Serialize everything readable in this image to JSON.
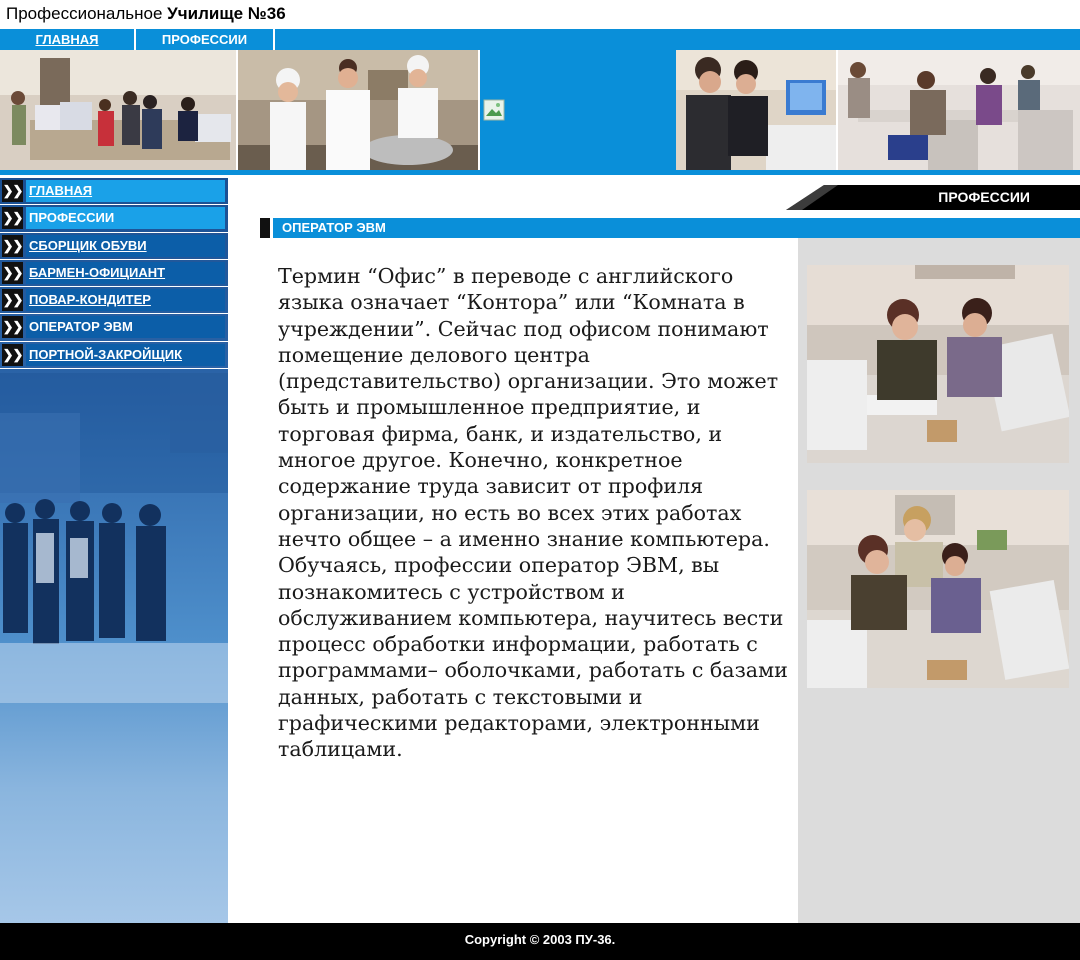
{
  "window": {
    "title_regular": "Профессиональное ",
    "title_bold": "Училище №36"
  },
  "topnav": {
    "items": [
      {
        "label": "ГЛАВНАЯ"
      },
      {
        "label": "ПРОФЕССИИ"
      }
    ]
  },
  "sidebar": {
    "bullet": "❯❯",
    "items": [
      {
        "label": "ГЛАВНАЯ"
      },
      {
        "label": "ПРОФЕССИИ"
      },
      {
        "label": "СБОРЩИК ОБУВИ"
      },
      {
        "label": "БАРМЕН-ОФИЦИАНТ"
      },
      {
        "label": "ПОВАР-КОНДИТЕР"
      },
      {
        "label": "ОПЕРАТОР ЭВМ"
      },
      {
        "label": "ПОРТНОЙ-ЗАКРОЙЩИК"
      }
    ]
  },
  "content": {
    "category_tab": "ПРОФЕССИИ",
    "section_title": "ОПЕРАТОР ЭВМ",
    "paragraphs": [
      "Термин “Офис” в переводе с английского языка означает “Контора” или “Комната в учреждении”. Сейчас под офисом понимают помещение делового центра (представительство) организации. Это может быть и промышленное предприятие, и торговая фирма, банк, и издательство, и многое другое. Конечно, конкретное содержание труда зависит от профиля организации, но есть во всех этих работах нечто общее – а именно знание компьютера.",
      "Обучаясь, профессии оператор ЭВМ, вы познакомитесь с устройством и обслуживанием компьютера, научитесь вести процесс обработки информации, работать с программами– оболочками, работать с базами данных, работать с текстовыми и графическими редакторами, электронными таблицами."
    ]
  },
  "footer": {
    "copyright": "Copyright © 2003 ПУ-36."
  },
  "colors": {
    "accent": "#0a8fd9",
    "dark_blue": "#0c5ea8",
    "black": "#000000",
    "panel_gray": "#dcdcdc"
  }
}
